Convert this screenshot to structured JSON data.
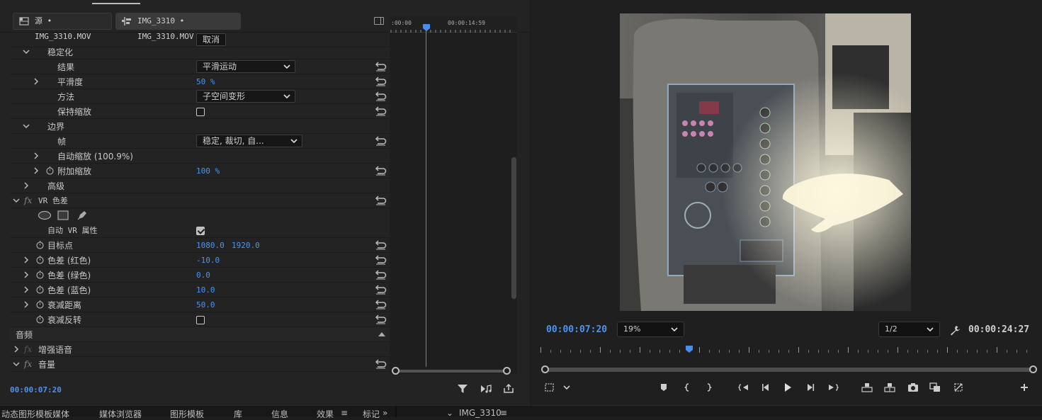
{
  "tabs": [
    {
      "label": "源 • IMG_3310.MOV",
      "active": false
    },
    {
      "label": "IMG_3310 • IMG_3310.MOV",
      "active": true
    }
  ],
  "effect_controls": {
    "cancel_label": "取消",
    "stabilizer": {
      "title": "稳定化",
      "result_label": "结果",
      "result_value": "平滑运动",
      "smoothness_label": "平滑度",
      "smoothness_value": "50 %",
      "method_label": "方法",
      "method_value": "子空间变形",
      "preserve_scale_label": "保持缩放",
      "preserve_scale_checked": false,
      "borders_label": "边界",
      "framing_label": "帧",
      "framing_value": "稳定, 裁切, 自...",
      "auto_scale_label": "自动缩放 (100.9%)",
      "additional_scale_label": "附加缩放",
      "additional_scale_value": "100 %",
      "advanced_label": "高级"
    },
    "vr_chroma": {
      "title": "VR 色差",
      "auto_vr_label": "自动 VR 属性",
      "auto_vr_checked": true,
      "target_point_label": "目标点",
      "target_point_x": "1080.0",
      "target_point_y": "1920.0",
      "red_label": "色差 (红色)",
      "red_value": "-10.0",
      "green_label": "色差 (绿色)",
      "green_value": "0.0",
      "blue_label": "色差 (蓝色)",
      "blue_value": "10.0",
      "falloff_label": "衰减距离",
      "falloff_value": "50.0",
      "invert_falloff_label": "衰减反转",
      "invert_falloff_checked": false
    },
    "audio_section_label": "音频",
    "enhance_speech_label": "增强语音",
    "volume_label": "音量",
    "current_timecode": "00:00:07:20"
  },
  "mini_timeline": {
    "tick_left": ":00:00",
    "tick_right": "00:00:14:59"
  },
  "program_monitor": {
    "current_timecode": "00:00:07:20",
    "zoom_value": "19%",
    "resolution_value": "1/2",
    "duration_timecode": "00:00:24:27"
  },
  "bottom_tabs": [
    "动态图形模板媒体",
    "媒体浏览器",
    "图形模板",
    "库",
    "信息",
    "效果",
    "标记",
    "IMG_3310"
  ],
  "colors": {
    "accent_blue": "#4d94f0",
    "panel_bg": "#232323",
    "app_bg": "#1d1d1d"
  }
}
